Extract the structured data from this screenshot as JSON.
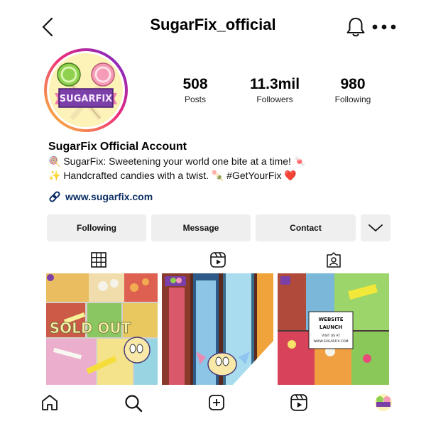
{
  "header": {
    "username": "SugarFix_official"
  },
  "profile": {
    "avatar_text": "SUGARFIX",
    "stats": [
      {
        "value": "508",
        "label": "Posts"
      },
      {
        "value": "11.3mil",
        "label": "Followers"
      },
      {
        "value": "980",
        "label": "Following"
      }
    ],
    "name": "SugarFix Official Account",
    "bio_line_1": "🍭 SugarFix: Sweetening your world one bite at a time! 🍬",
    "bio_line_2": "✨ Handcrafted candies with a twist. 🍡 #GetYourFix ❤️",
    "website": "www.sugarfix.com"
  },
  "actions": {
    "following_label": "Following",
    "message_label": "Message",
    "contact_label": "Contact"
  },
  "posts": {
    "post_1_overlay": "SOLD OUT",
    "post_3_card_lines": [
      "WEBSITE",
      "LAUNCH",
      "VISIT US AT",
      "WWW.SUGARFIX.COM"
    ]
  },
  "icons": {
    "back": "chevron-left-icon",
    "bell": "bell-icon",
    "more": "more-horizontal-icon",
    "link": "link-icon",
    "dropdown": "chevron-down-icon",
    "grid_tab": "grid-icon",
    "reels_tab": "reels-icon",
    "tagged_tab": "tagged-icon",
    "home": "home-icon",
    "search": "search-icon",
    "create": "plus-square-icon",
    "reels": "reels-icon"
  },
  "colors": {
    "link": "#0b2e63",
    "button_bg": "#efefef",
    "brand_purple": "#7b3fa8",
    "brand_pink": "#ef7fb0",
    "brand_yellow": "#fdf3b8"
  }
}
